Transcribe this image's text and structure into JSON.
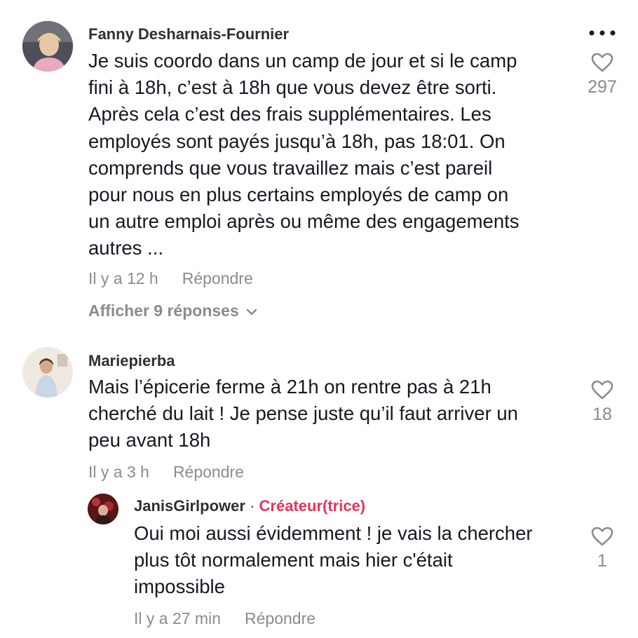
{
  "comments": [
    {
      "username": "Fanny Desharnais-Fournier",
      "lines": [
        "Je suis coordo dans un camp de jour et si le camp",
        "fini à 18h, c’est à 18h que vous devez être sorti.",
        "Après cela c’est des frais supplémentaires. Les",
        "employés sont payés jusqu’à 18h, pas 18:01. On",
        "comprends que vous travaillez mais c’est pareil",
        "pour nous en plus certains employés de camp on",
        "un autre emploi après ou même des engagements",
        "autres ..."
      ],
      "time": "Il y a 12 h",
      "reply_label": "Répondre",
      "likes": "297",
      "view_replies": "Afficher 9 réponses"
    },
    {
      "username": "Mariepierba",
      "lines": [
        "Mais l’épicerie ferme à 21h on rentre pas à 21h",
        "cherché du lait ! Je pense juste qu’il faut arriver un",
        "peu avant 18h"
      ],
      "time": "Il y a 3 h",
      "reply_label": "Répondre",
      "likes": "18"
    }
  ],
  "reply": {
    "username": "JanisGirlpower",
    "separator": "·",
    "badge": "Créateur(trice)",
    "lines": [
      "Oui moi aussi évidemment ! je vais la chercher",
      "plus tôt normalement mais hier c'était",
      "impossible"
    ],
    "time": "Il y a 27 min",
    "reply_label": "Répondre",
    "likes": "1"
  },
  "icons": {
    "more": "more-horizontal-icon",
    "like": "heart-outline-icon",
    "expand": "chevron-down-icon"
  },
  "colors": {
    "text": "#161823",
    "muted": "#8a8b91",
    "creator_badge": "#e5345e"
  }
}
